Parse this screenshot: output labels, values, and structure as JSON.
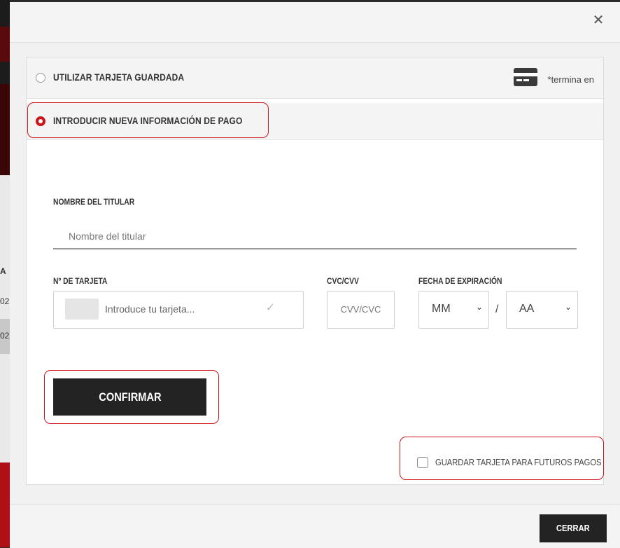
{
  "background": {
    "snippet_a": "A",
    "snippet_b": "02",
    "snippet_c": "02"
  },
  "modal": {
    "close_icon": "close-icon",
    "options": {
      "saved_card_label": "UTILIZAR TARJETA GUARDADA",
      "saved_card_ending": "*termina en",
      "new_card_label": "INTRODUCIR NUEVA INFORMACIÓN DE PAGO"
    },
    "form": {
      "holder_label": "NOMBRE DEL TITULAR",
      "holder_placeholder": "Nombre del titular",
      "card_label": "Nº DE TARJETA",
      "card_placeholder": "Introduce tu tarjeta...",
      "cvc_label": "CVC/CVV",
      "cvc_placeholder": "CVV/CVC",
      "expiry_label": "FECHA DE EXPIRACIÓN",
      "month_value": "MM",
      "year_value": "AA",
      "separator": "/",
      "confirm_label": "CONFIRMAR",
      "save_card_label": "GUARDAR TARJETA PARA FUTUROS PAGOS"
    },
    "footer": {
      "close_label": "CERRAR"
    }
  },
  "colors": {
    "accent": "#d0141a",
    "button": "#232323"
  }
}
